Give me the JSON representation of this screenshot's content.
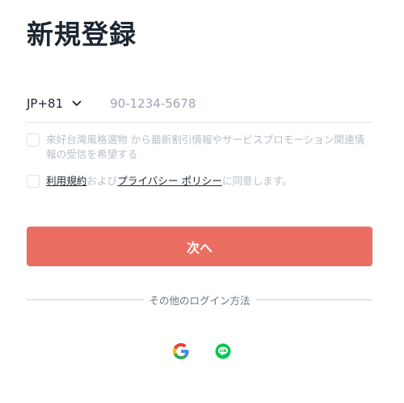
{
  "header": {
    "title": "新規登録"
  },
  "phone": {
    "country_code": "JP+81",
    "placeholder": "90-1234-5678",
    "value": ""
  },
  "consent": {
    "marketing_text": "來好台灣風格選物 から最新割引情報やサービスプロモーション関連情報の受信を希望する",
    "terms_link": "利用規約",
    "terms_and": "および",
    "privacy_link": "プライバシー ポリシー",
    "terms_suffix": "に同意します。"
  },
  "actions": {
    "next_label": "次へ"
  },
  "divider": {
    "label": "その他のログイン方法"
  },
  "social": {
    "icons": [
      "google-icon",
      "line-icon"
    ]
  },
  "colors": {
    "primary_button": "#ea6e62",
    "google_blue": "#4285F4",
    "google_red": "#EA4335",
    "google_yellow": "#FBBC05",
    "google_green": "#34A853",
    "line_green": "#06C755"
  }
}
